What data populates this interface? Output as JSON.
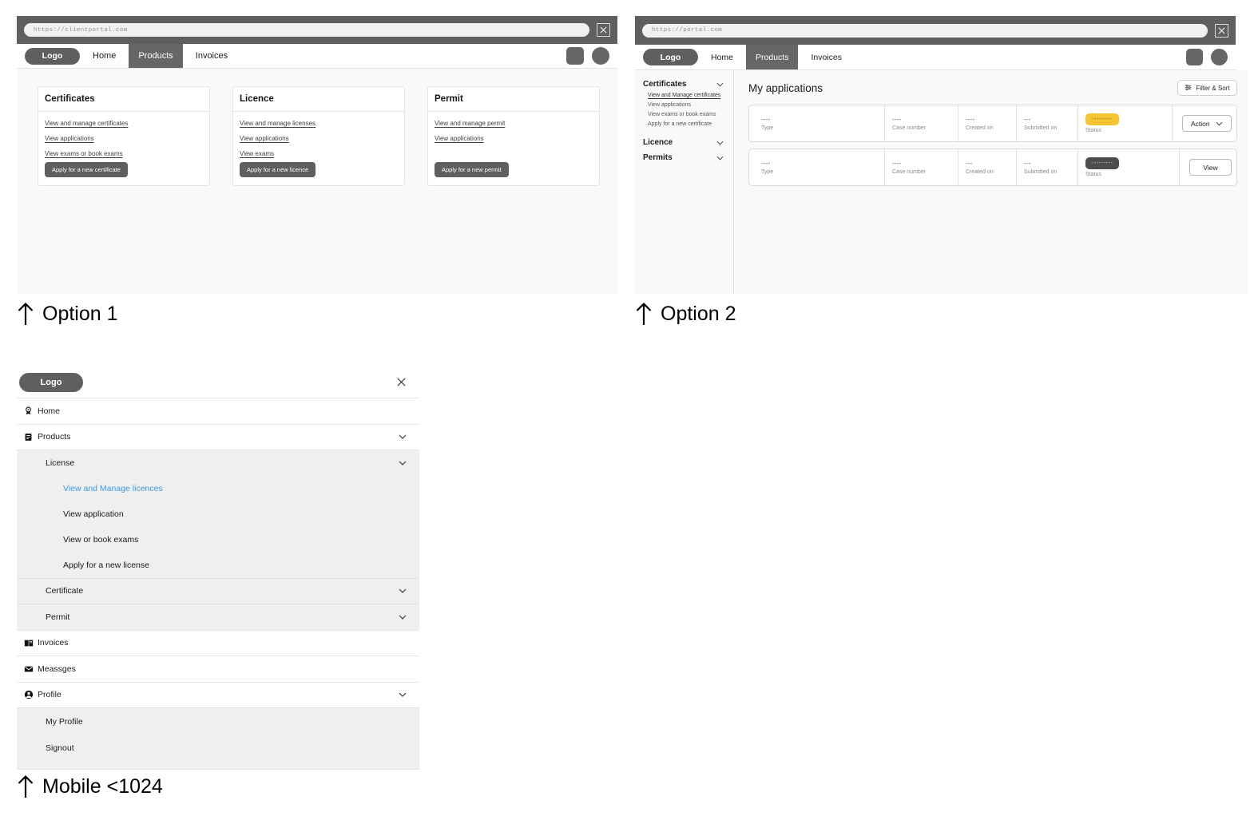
{
  "option1": {
    "caption": "Option 1",
    "browser": {
      "url": "https://clientportal.com",
      "close_icon": "close-icon"
    },
    "nav": {
      "logo": "Logo",
      "links": [
        {
          "label": "Home",
          "active": false
        },
        {
          "label": "Products",
          "active": true
        },
        {
          "label": "Invoices",
          "active": false
        }
      ]
    },
    "cards": [
      {
        "title": "Certificates",
        "links": [
          "View and manage certificates",
          "View applications",
          "View exams or book exams"
        ],
        "button": "Apply for a new certificate"
      },
      {
        "title": "Licence",
        "links": [
          "View and manage licenses",
          "View applications",
          "View exams"
        ],
        "button": "Apply for a new licence"
      },
      {
        "title": "Permit",
        "links": [
          "View and manage permit",
          "View applications"
        ],
        "button": "Apply for a new permit"
      }
    ]
  },
  "option2": {
    "caption": "Option 2",
    "browser": {
      "url": "https://portal.com",
      "close_icon": "close-icon"
    },
    "nav": {
      "logo": "Logo",
      "links": [
        {
          "label": "Home",
          "active": false
        },
        {
          "label": "Products",
          "active": true
        },
        {
          "label": "Invoices",
          "active": false
        }
      ]
    },
    "sidebar": [
      {
        "label": "Certificates",
        "expanded": true,
        "items": [
          {
            "label": "View and Manage certificates",
            "active": true
          },
          {
            "label": "View applications",
            "active": false
          },
          {
            "label": "View exams or book exams",
            "active": false
          },
          {
            "label": "Apply for a new certificate",
            "active": false
          }
        ]
      },
      {
        "label": "Licence",
        "expanded": false,
        "items": []
      },
      {
        "label": "Permits",
        "expanded": false,
        "items": []
      }
    ],
    "main": {
      "title": "My applications",
      "filter_button": "Filter & Sort",
      "columns": [
        "Type",
        "Case number",
        "Created on",
        "Submitted on",
        "Status"
      ],
      "rows": [
        {
          "type": "----",
          "case_number": "----",
          "created_on": "----",
          "submitted_on": "---",
          "status": "---------",
          "status_color": "#f5c431",
          "action_label": "Action",
          "action_type": "dropdown"
        },
        {
          "type": "----",
          "case_number": "----",
          "created_on": "---",
          "submitted_on": "---",
          "status": "---------",
          "status_color": "#4d4d4d",
          "action_label": "View",
          "action_type": "button"
        }
      ]
    }
  },
  "mobile": {
    "caption": "Mobile <1024",
    "logo": "Logo",
    "close_icon": "close-icon",
    "menu": {
      "home": {
        "label": "Home",
        "icon": "badge-icon"
      },
      "products": {
        "label": "Products",
        "icon": "document-icon"
      },
      "license": {
        "label": "License",
        "items": [
          {
            "label": "View and Manage licences",
            "highlight": true
          },
          {
            "label": "View application",
            "highlight": false
          },
          {
            "label": "View or book exams",
            "highlight": false
          },
          {
            "label": "Apply for a new license",
            "highlight": false
          }
        ]
      },
      "certificate": {
        "label": "Certificate"
      },
      "permit": {
        "label": "Permit"
      },
      "invoices": {
        "label": "Invoices",
        "icon": "book-icon"
      },
      "messages": {
        "label": "Meassges",
        "icon": "mail-icon"
      },
      "profile": {
        "label": "Profile",
        "icon": "user-icon",
        "items": [
          {
            "label": "My Profile"
          },
          {
            "label": "Signout"
          }
        ]
      }
    }
  },
  "colors": {
    "chrome": "#5f5f5f",
    "accent_dark": "#666666",
    "status_warning": "#f5c431",
    "status_dark": "#4d4d4d",
    "link_blue": "#3d9ae0",
    "page_bg": "#faf9f8"
  }
}
